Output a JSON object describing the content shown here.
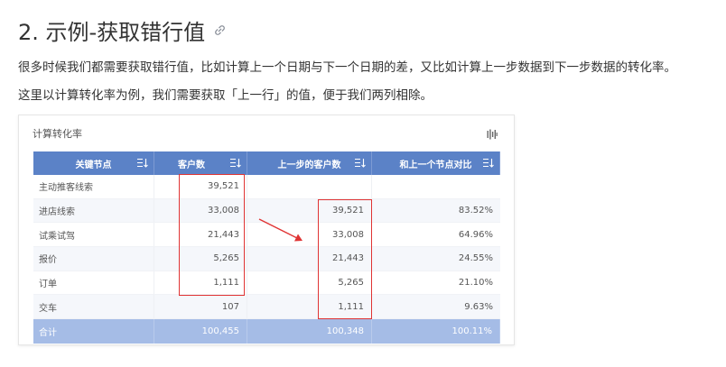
{
  "heading": {
    "title": "2. 示例-获取错行值",
    "link_icon": "link-icon"
  },
  "paragraphs": {
    "p1": "很多时候我们都需要获取错行值，比如计算上一个日期与下一个日期的差，又比如计算上一步数据到下一步数据的转化率。",
    "p2": "这里以计算转化率为例，我们需要获取「上一行」的值，便于我们两列相除。"
  },
  "card": {
    "title": "计算转化率",
    "tool_icon": "chart-settings-icon"
  },
  "table": {
    "headers": [
      "关键节点",
      "客户数",
      "上一步的客户数",
      "和上一个节点对比"
    ],
    "rows": [
      [
        "主动推客线索",
        "39,521",
        "",
        ""
      ],
      [
        "进店线索",
        "33,008",
        "39,521",
        "83.52%"
      ],
      [
        "试乘试驾",
        "21,443",
        "33,008",
        "64.96%"
      ],
      [
        "报价",
        "5,265",
        "21,443",
        "24.55%"
      ],
      [
        "订单",
        "1,111",
        "5,265",
        "21.10%"
      ],
      [
        "交车",
        "107",
        "1,111",
        "9.63%"
      ]
    ],
    "footer": [
      "合计",
      "100,455",
      "100,348",
      "100.11%"
    ]
  },
  "colors": {
    "header_bg": "#5b82c7",
    "footer_bg": "#a5bce6",
    "highlight": "#e03434"
  }
}
